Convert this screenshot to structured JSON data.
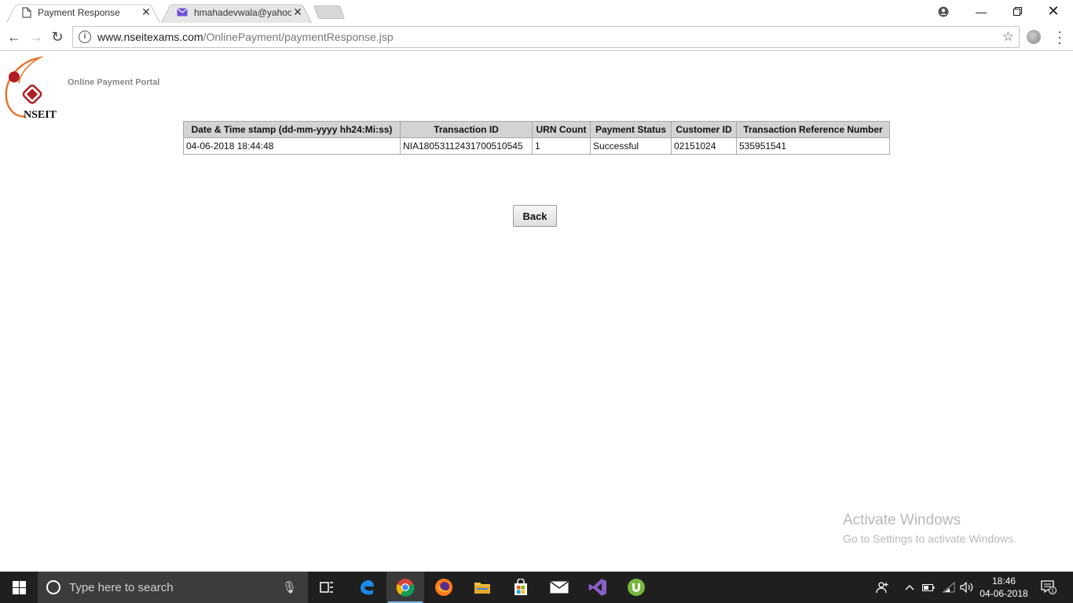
{
  "browser": {
    "tabs": [
      {
        "title": "Payment Response",
        "active": true
      },
      {
        "title": "hmahadevwala@yahoo.c",
        "active": false
      }
    ],
    "url_host": "www.nseitexams.com",
    "url_path": "/OnlinePayment/paymentResponse.jsp"
  },
  "page": {
    "logo_text": "NSEIT",
    "portal_title": "Online Payment Portal",
    "table": {
      "headers": [
        "Date & Time stamp (dd-mm-yyyy hh24:Mi:ss)",
        "Transaction ID",
        "URN Count",
        "Payment Status",
        "Customer ID",
        "Transaction Reference Number"
      ],
      "rows": [
        [
          "04-06-2018 18:44:48",
          "NIA18053112431700510545",
          "1",
          "Successful",
          "02151024",
          "535951541"
        ]
      ]
    },
    "back_label": "Back"
  },
  "watermark": {
    "line1": "Activate Windows",
    "line2": "Go to Settings to activate Windows."
  },
  "taskbar": {
    "search_placeholder": "Type here to search",
    "time": "18:46",
    "date": "04-06-2018",
    "notification_count": "1"
  },
  "colors": {
    "taskbar": "#1f1f1f",
    "logo_orange": "#e8742a",
    "logo_red": "#b01e23"
  }
}
